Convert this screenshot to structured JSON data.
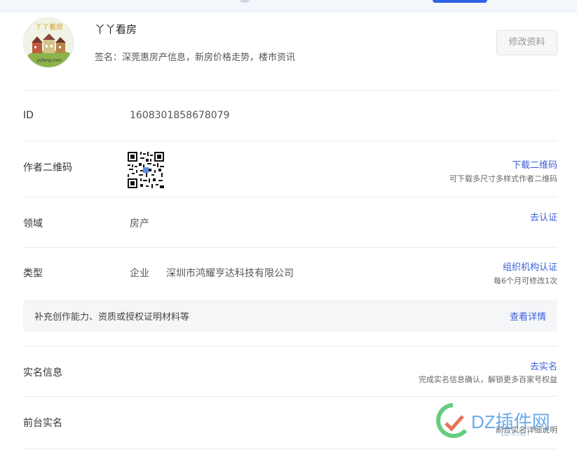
{
  "profile": {
    "name": "丫丫看房",
    "signature": "签名：深莞惠房产信息，新房价格走势，楼市资讯",
    "edit_button": "修改资料",
    "avatar_text": "丫丫看房",
    "avatar_url_text": "yyfang.com"
  },
  "rows": {
    "id": {
      "label": "ID",
      "value": "1608301858678079"
    },
    "qrcode": {
      "label": "作者二维码",
      "action": "下载二维码",
      "sub": "可下载多尺寸多样式作者二维码"
    },
    "field": {
      "label": "领域",
      "value": "房产",
      "action": "去认证"
    },
    "type": {
      "label": "类型",
      "value": "企业",
      "company": "深圳市鸿耀亨达科技有限公司",
      "action": "组织机构认证",
      "sub": "每6个月可修改1次"
    },
    "realname": {
      "label": "实名信息",
      "action": "去实名",
      "sub": "完成实名信息确认，解锁更多百家号权益"
    },
    "front_realname": {
      "label": "前台实名",
      "sub": "前台实名详细说明"
    }
  },
  "notice": {
    "text": "补充创作能力、资质或授权证明材料等",
    "link": "查看详情"
  },
  "watermark": {
    "text": "DZ插件网",
    "sub": "DZ-X.NET"
  },
  "colors": {
    "accent": "#3b5fd8",
    "topbar_button": "#2f63e6"
  }
}
